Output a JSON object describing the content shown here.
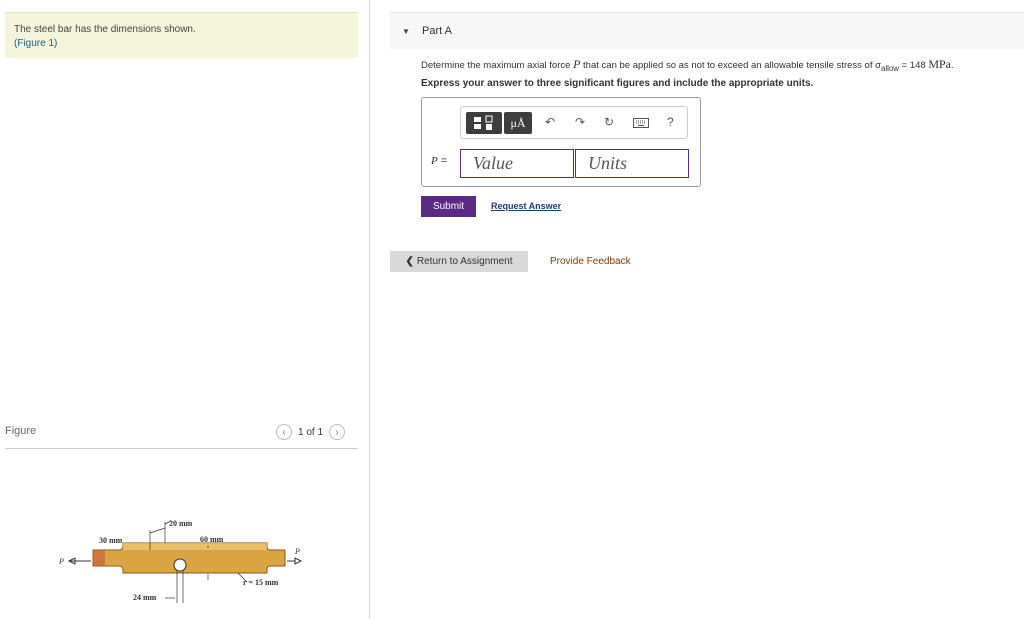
{
  "intro": {
    "text": "The steel bar has the dimensions shown.",
    "figure_link": "(Figure 1)"
  },
  "figure": {
    "label": "Figure",
    "pager": "1 of 1",
    "prev_icon": "chevron-left-icon",
    "next_icon": "chevron-right-icon",
    "diagram": {
      "dim_20": "20 mm",
      "dim_60": "60 mm",
      "dim_30": "30 mm",
      "dim_24": "24 mm",
      "dim_r": "r = 15 mm",
      "load_left": "P",
      "load_right": "P"
    }
  },
  "part": {
    "collapse_icon": "triangle-down-icon",
    "title": "Part A",
    "question_pre": "Determine the maximum axial force ",
    "question_var": "P",
    "question_mid": " that can be applied so as not to exceed an allowable tensile stress of σ",
    "question_sub": "allow",
    "question_eq": " = 148 ",
    "question_unit": "MPa",
    "question_end": ".",
    "instruction": "Express your answer to three significant figures and include the appropriate units."
  },
  "toolbar": {
    "templates_icon": "templates-icon",
    "units_label": "μÅ",
    "undo_icon": "undo-icon",
    "redo_icon": "redo-icon",
    "reset_icon": "reset-icon",
    "keyboard_icon": "keyboard-icon",
    "help_label": "?"
  },
  "answer": {
    "variable": "P",
    "equals": "=",
    "value_placeholder": "Value",
    "units_placeholder": "Units"
  },
  "actions": {
    "submit": "Submit",
    "request_answer": "Request Answer",
    "return": "Return to Assignment",
    "feedback": "Provide Feedback"
  },
  "colors": {
    "accent": "#5b2a86",
    "intro_bg": "#f3f4d9",
    "bar_gold": "#d9a441"
  }
}
